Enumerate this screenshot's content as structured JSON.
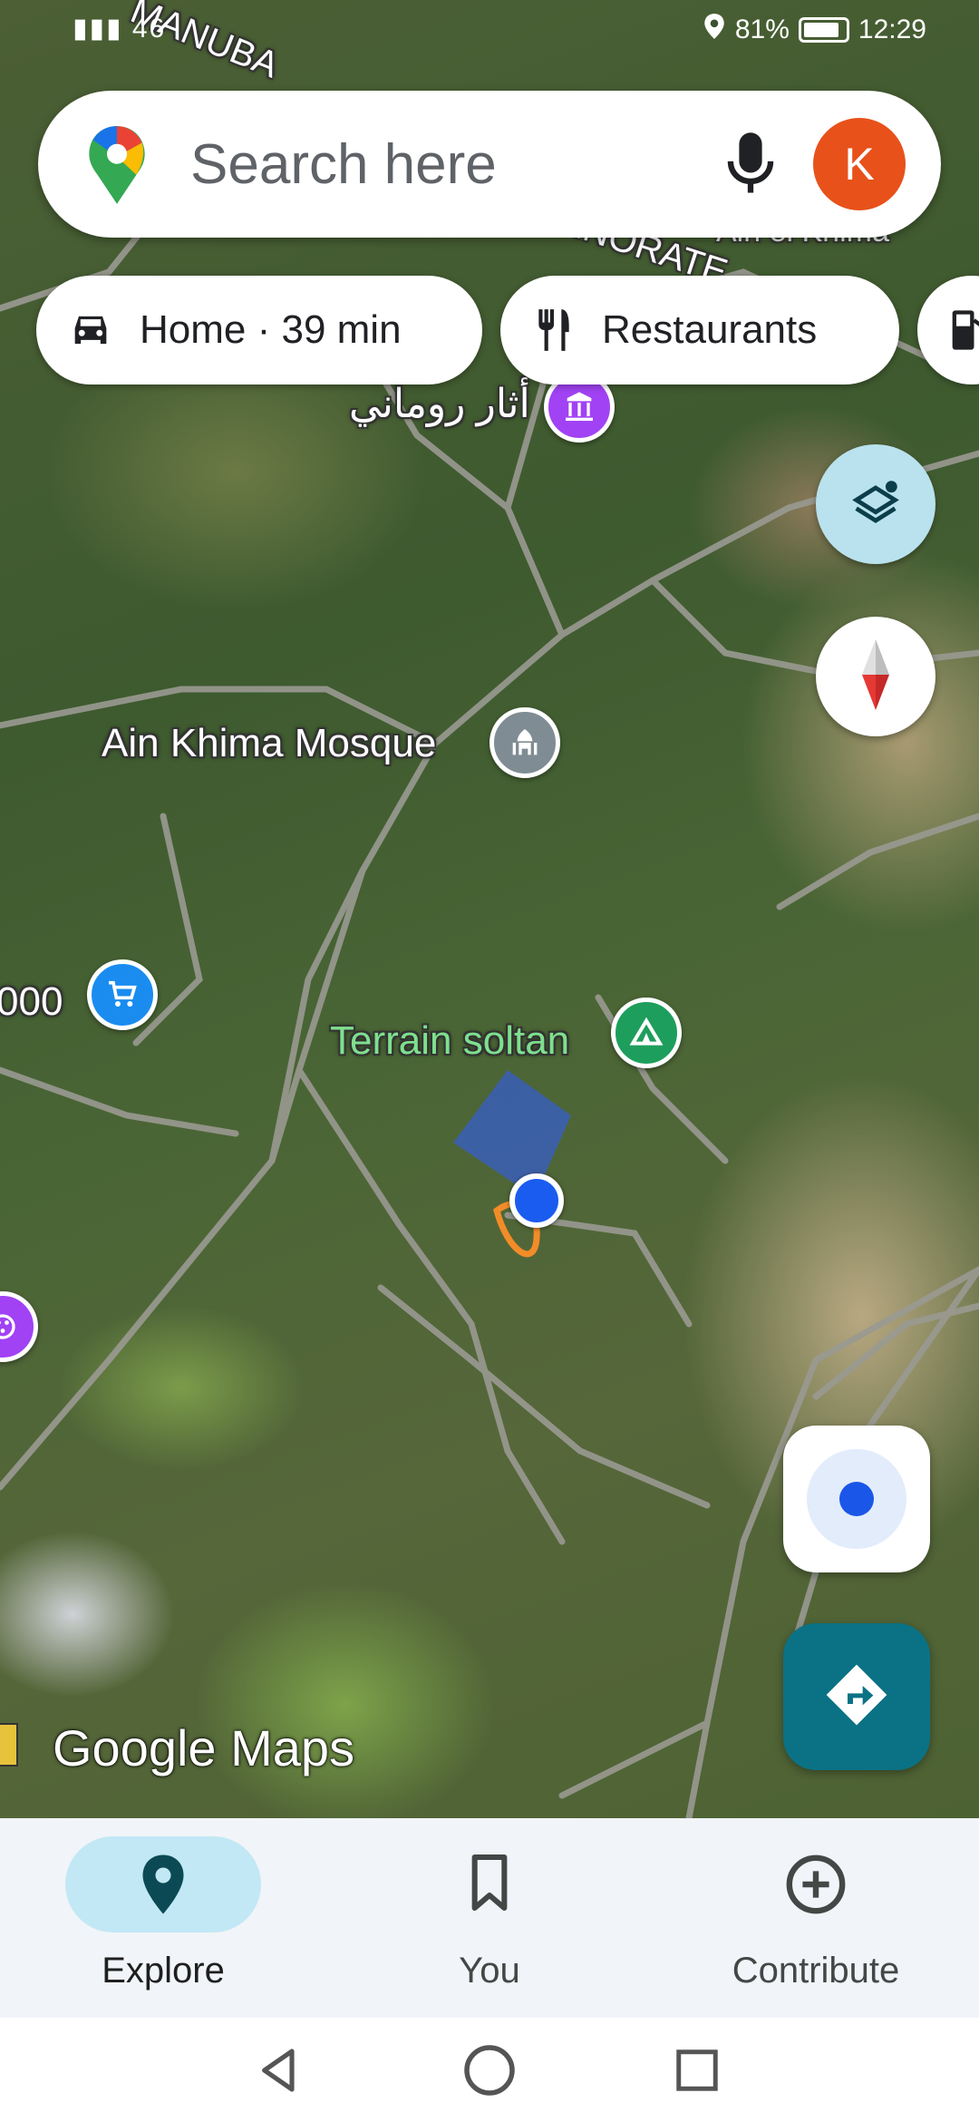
{
  "status_bar": {
    "signal_text": "46",
    "battery_percent": "81%",
    "time": "12:29"
  },
  "search": {
    "placeholder": "Search here",
    "avatar_initial": "K"
  },
  "chips": [
    {
      "label": "Home · 39 min",
      "icon": "car-icon"
    },
    {
      "label": "Restaurants",
      "icon": "restaurant-icon"
    },
    {
      "label": "",
      "icon": "gas-station-icon"
    }
  ],
  "map": {
    "map_type": "satellite",
    "overlay_text": {
      "top_a": "MANUBA",
      "top_b": "GOVERNORATE",
      "top_c": "Ain el Khima"
    },
    "places": {
      "roman_ruins": "أثار روماني",
      "mosque": "Ain Khima Mosque",
      "terrain": "Terrain soltan",
      "shop_left": "000"
    },
    "watermark": "Google Maps"
  },
  "colors": {
    "accent_blue": "#1a73e8",
    "avatar": "#e8511a",
    "directions_fab": "#0b7285",
    "nav_active_pill": "#c2e8f5",
    "camping_poi": "#1e9e5c",
    "museum_poi": "#a142f4",
    "shop_poi": "#1a8cf0"
  },
  "bottom_nav": [
    {
      "label": "Explore",
      "icon": "location-pin-icon",
      "active": true
    },
    {
      "label": "You",
      "icon": "bookmark-icon",
      "active": false
    },
    {
      "label": "Contribute",
      "icon": "add-circle-icon",
      "active": false
    }
  ]
}
